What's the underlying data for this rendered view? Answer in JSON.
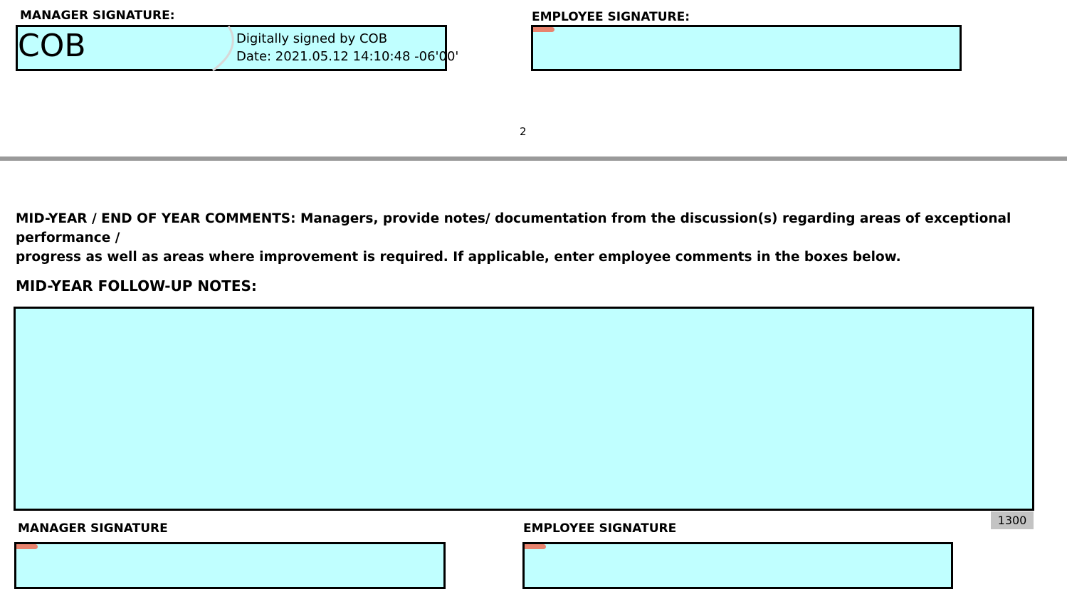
{
  "top_section": {
    "manager_label": "MANAGER SIGNATURE:",
    "employee_label": "EMPLOYEE SIGNATURE:",
    "signature": {
      "name": "COB",
      "signed_line": "Digitally signed by COB",
      "date_line": "Date: 2021.05.12 14:10:48 -06'00'"
    },
    "page_number": "2"
  },
  "comments": {
    "instructions_line1": "MID-YEAR / END OF YEAR COMMENTS: Managers, provide notes/ documentation from the discussion(s) regarding areas of exceptional performance /",
    "instructions_line2": "progress as well as areas where improvement is required.  If applicable, enter employee comments in the boxes below.",
    "notes_label": "MID-YEAR FOLLOW-UP NOTES:",
    "char_limit": "1300"
  },
  "bottom_section": {
    "manager_label": "MANAGER SIGNATURE",
    "employee_label": "EMPLOYEE SIGNATURE"
  },
  "colors": {
    "field_fill": "#c0ffff",
    "sign_tag": "#e8836e",
    "divider": "#9a9a9a"
  }
}
